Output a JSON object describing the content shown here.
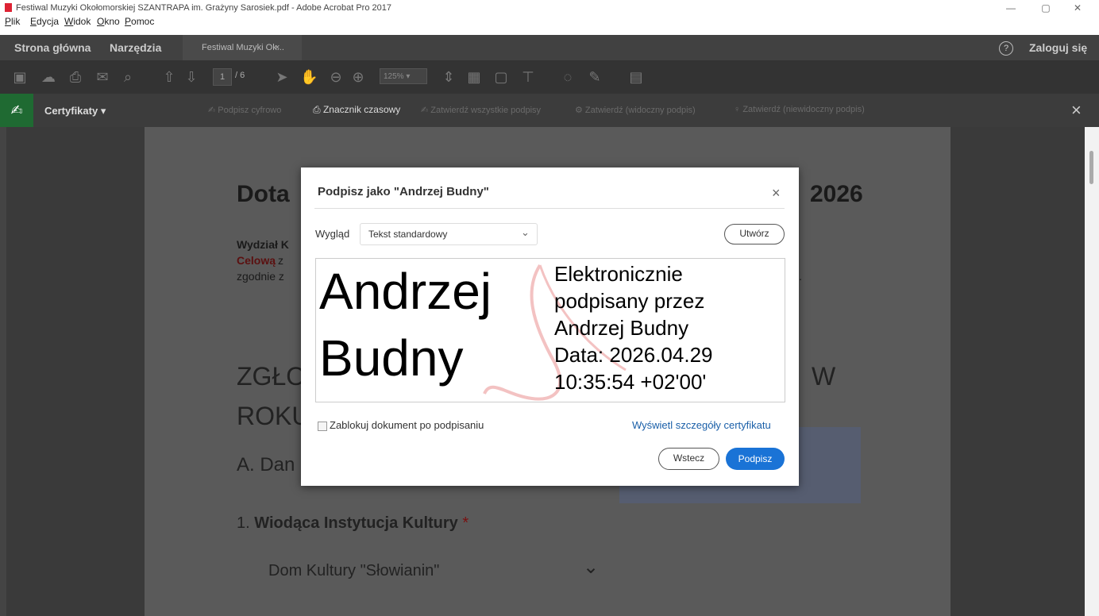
{
  "window": {
    "title": "Festiwal Muzyki Okołomorskiej SZANTRAPA im. Grażyny Sarosiek.pdf - Adobe Acrobat Pro 2017",
    "minimize": "—",
    "restore": "▢",
    "close": "✕"
  },
  "menu": [
    "Plik",
    "Edycja",
    "Widok",
    "Okno",
    "Pomoc"
  ],
  "tabs": {
    "home": "Strona główna",
    "tools": "Narzędzia",
    "doc_tab": "Festiwal Muzyki Ok...",
    "doc_tab_close": "×",
    "help": "?",
    "login": "Zaloguj się"
  },
  "toolbar": {
    "page_current": "1",
    "page_total": "/ 6",
    "zoom": "125%"
  },
  "certbar": {
    "label": "Certyfikaty",
    "actions": [
      "Podpisz cyfrowo",
      "Znacznik czasowy",
      "Zatwierdź wszystkie podpisy",
      "Zatwierdź (widoczny podpis)",
      "Zatwierdź (niewidoczny podpis)"
    ],
    "close": "×"
  },
  "document": {
    "heading_left": "Dota",
    "heading_right": "2026",
    "wydzial": "Wydział K",
    "celowa": "Celową",
    "celowa_rest": "z",
    "zgodnie": "zgodnie z",
    "dot": ".",
    "zglo": "ZGŁO",
    "w": "W",
    "roku": "ROKU",
    "adane": "A. Dan",
    "inst_num": "1.",
    "inst_label": "Wiodąca Instytucja Kultury",
    "inst_star": "*",
    "dom": "Dom Kultury \"Słowianin\""
  },
  "dialog": {
    "title": "Podpisz jako \"Andrzej Budny\"",
    "close": "×",
    "appearance_label": "Wygląd",
    "appearance_value": "Tekst standardowy",
    "create_button": "Utwórz",
    "signature": {
      "name_line1": "Andrzej",
      "name_line2": "Budny",
      "details": [
        "Elektronicznie",
        "podpisany przez",
        "Andrzej Budny",
        "Data: 2026.04.29",
        "10:35:54 +02'00'"
      ]
    },
    "lock_label": "Zablokuj dokument po podpisaniu",
    "lock_checked": false,
    "cert_link": "Wyświetl szczegóły certyfikatu",
    "back_button": "Wstecz",
    "sign_button": "Podpisz"
  },
  "colors": {
    "accent": "#1a73d6",
    "cert_green": "#1f6a32",
    "link": "#1a5fa8"
  }
}
